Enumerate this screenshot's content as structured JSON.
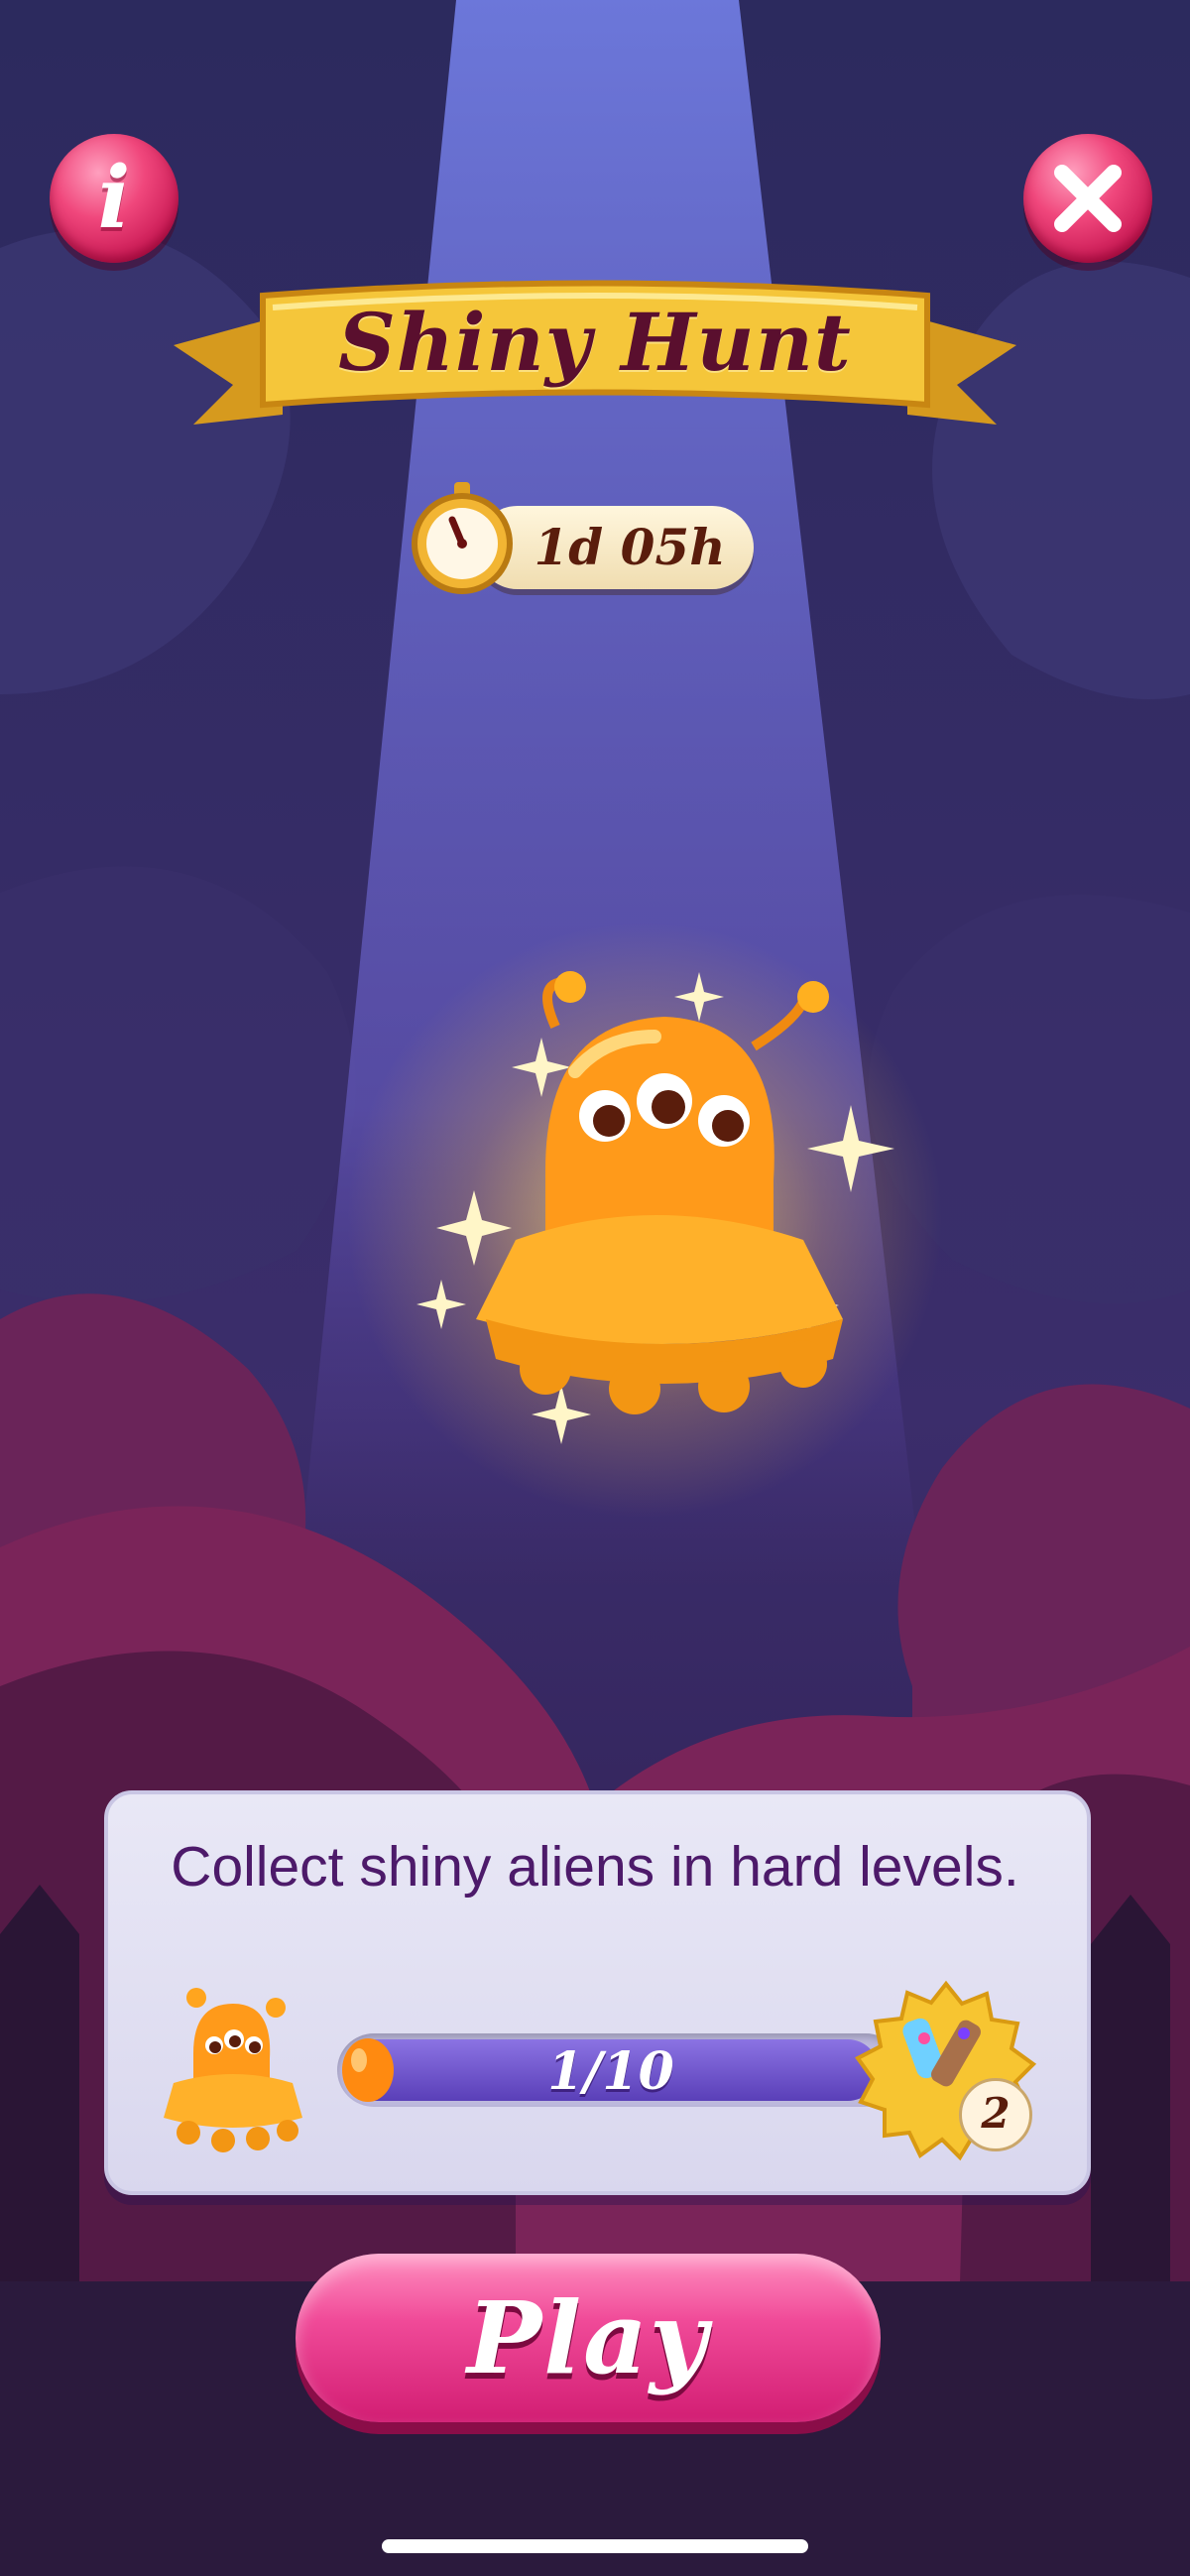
{
  "header": {
    "title": "Shiny Hunt",
    "timer": "1d 05h"
  },
  "buttons": {
    "info_icon": "info-icon",
    "close_icon": "close-icon"
  },
  "panel": {
    "description": "Collect shiny aliens in hard levels.",
    "progress_text": "1/10",
    "progress_value": 0.1,
    "reward_count": "2"
  },
  "play": {
    "label": "Play"
  },
  "colors": {
    "accent_pink": "#f04a98",
    "banner_gold": "#f5c63a",
    "progress_purple": "#6a4fcf"
  }
}
